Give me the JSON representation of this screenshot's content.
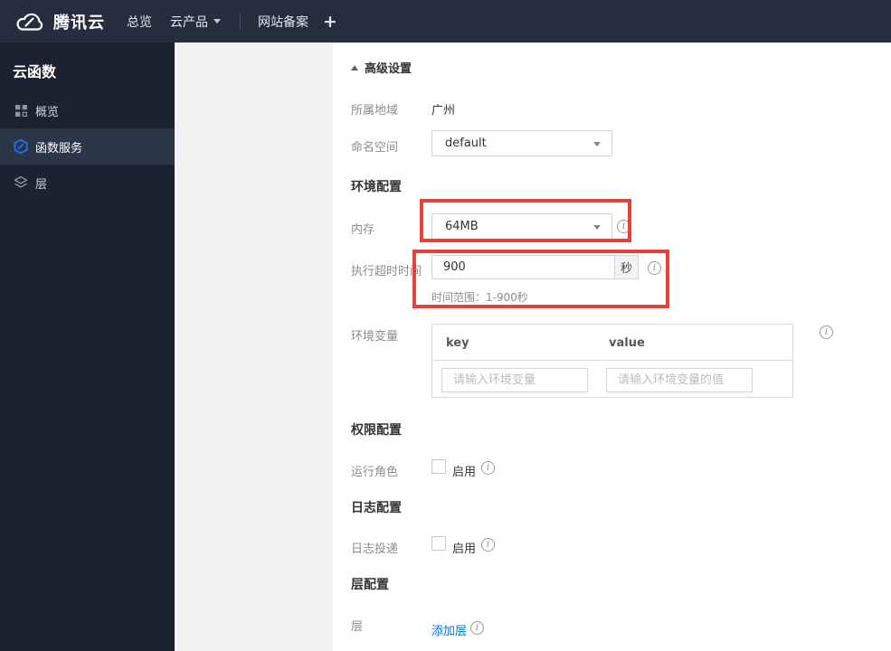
{
  "colors": {
    "topbar_bg": "#262e3d",
    "sidebar_bg": "#1c2330",
    "sidebar_selected_bg": "#2b3648",
    "accent_blue": "#006eff",
    "highlight_red": "#e5413d",
    "grey_panel": "#f2f2f2"
  },
  "icons": {
    "info_glyph": "i"
  },
  "topbar": {
    "brand": "腾讯云",
    "nav_overview": "总览",
    "nav_products": "云产品",
    "nav_icp": "网站备案",
    "nav_plus": "+"
  },
  "sidebar": {
    "title": "云函数",
    "items": [
      {
        "label": "概览",
        "icon": "grid-icon",
        "selected": false
      },
      {
        "label": "函数服务",
        "icon": "scf-hexagon-icon",
        "selected": true
      },
      {
        "label": "层",
        "icon": "layers-icon",
        "selected": false
      }
    ]
  },
  "content": {
    "advanced_settings": "高级设置",
    "sections": {
      "env": "环境配置",
      "perm": "权限配置",
      "log": "日志配置",
      "layer": "层配置"
    },
    "rows": {
      "region": {
        "label": "所属地域",
        "value": "广州"
      },
      "namespace": {
        "label": "命名空间",
        "value": "default"
      },
      "memory": {
        "label": "内存",
        "value": "64MB"
      },
      "timeout": {
        "label": "执行超时时间",
        "value": "900",
        "unit": "秒",
        "hint": "时间范围：1-900秒"
      },
      "envvars": {
        "label": "环境变量",
        "key_header": "key",
        "value_header": "value",
        "key_placeholder": "请输入环境变量",
        "value_placeholder": "请输入环境变量的值"
      },
      "run_role": {
        "label": "运行角色",
        "checkbox_label": "启用",
        "checked": false
      },
      "log_delivery": {
        "label": "日志投递",
        "checkbox_label": "启用",
        "checked": false
      },
      "layer": {
        "label": "层",
        "add_link": "添加层"
      }
    }
  }
}
